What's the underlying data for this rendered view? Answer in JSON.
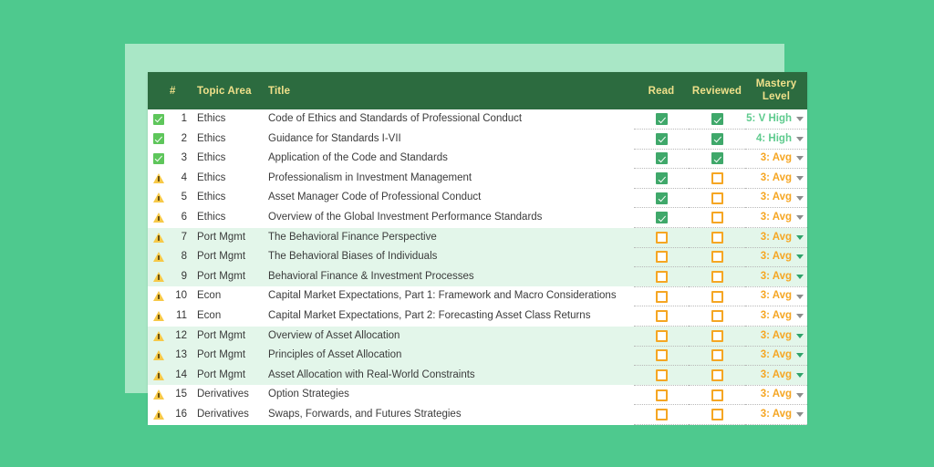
{
  "theme": {
    "page_background": "#4ec98e",
    "panel_background": "#a9e7c6",
    "card_background": "#ffffff",
    "header_background": "#2c6b3f",
    "header_text": "#efe08a",
    "row_alt_background": "#e3f6ea",
    "checked_box": "#3fa86a",
    "unchecked_box_border": "#f5a623",
    "mastery_green": "#5ecb8e",
    "mastery_orange": "#f5a623",
    "status_ok": "#5ec65b",
    "status_warn": "#f7c948"
  },
  "table": {
    "columns": {
      "status": "",
      "number": "#",
      "topic_area": "Topic Area",
      "title": "Title",
      "read": "Read",
      "reviewed": "Reviewed",
      "mastery_level_line1": "Mastery",
      "mastery_level_line2": "Level"
    },
    "rows": [
      {
        "status": "check-icon",
        "number": "1",
        "topic_area": "Ethics",
        "title": "Code of Ethics and Standards of Professional Conduct",
        "read": true,
        "reviewed": true,
        "mastery": "5: V High",
        "mastery_color": "green",
        "highlighted": false
      },
      {
        "status": "check-icon",
        "number": "2",
        "topic_area": "Ethics",
        "title": "Guidance for Standards I-VII",
        "read": true,
        "reviewed": true,
        "mastery": "4: High",
        "mastery_color": "green",
        "highlighted": false
      },
      {
        "status": "check-icon",
        "number": "3",
        "topic_area": "Ethics",
        "title": "Application of the Code and Standards",
        "read": true,
        "reviewed": true,
        "mastery": "3: Avg",
        "mastery_color": "orange",
        "highlighted": false
      },
      {
        "status": "warning-icon",
        "number": "4",
        "topic_area": "Ethics",
        "title": "Professionalism in Investment Management",
        "read": true,
        "reviewed": false,
        "mastery": "3: Avg",
        "mastery_color": "orange",
        "highlighted": false
      },
      {
        "status": "warning-icon",
        "number": "5",
        "topic_area": "Ethics",
        "title": "Asset Manager Code of Professional Conduct",
        "read": true,
        "reviewed": false,
        "mastery": "3: Avg",
        "mastery_color": "orange",
        "highlighted": false
      },
      {
        "status": "warning-icon",
        "number": "6",
        "topic_area": "Ethics",
        "title": "Overview of the Global Investment Performance Standards",
        "read": true,
        "reviewed": false,
        "mastery": "3: Avg",
        "mastery_color": "orange",
        "highlighted": false
      },
      {
        "status": "warning-icon",
        "number": "7",
        "topic_area": "Port Mgmt",
        "title": "The Behavioral Finance Perspective",
        "read": false,
        "reviewed": false,
        "mastery": "3: Avg",
        "mastery_color": "orange",
        "highlighted": true
      },
      {
        "status": "warning-icon",
        "number": "8",
        "topic_area": "Port Mgmt",
        "title": "The Behavioral Biases of Individuals",
        "read": false,
        "reviewed": false,
        "mastery": "3: Avg",
        "mastery_color": "orange",
        "highlighted": true
      },
      {
        "status": "warning-icon",
        "number": "9",
        "topic_area": "Port Mgmt",
        "title": "Behavioral Finance & Investment Processes",
        "read": false,
        "reviewed": false,
        "mastery": "3: Avg",
        "mastery_color": "orange",
        "highlighted": true
      },
      {
        "status": "warning-icon",
        "number": "10",
        "topic_area": "Econ",
        "title": "Capital Market Expectations, Part 1: Framework and Macro Considerations",
        "read": false,
        "reviewed": false,
        "mastery": "3: Avg",
        "mastery_color": "orange",
        "highlighted": false
      },
      {
        "status": "warning-icon",
        "number": "11",
        "topic_area": "Econ",
        "title": "Capital Market Expectations, Part 2: Forecasting Asset Class Returns",
        "read": false,
        "reviewed": false,
        "mastery": "3: Avg",
        "mastery_color": "orange",
        "highlighted": false
      },
      {
        "status": "warning-icon",
        "number": "12",
        "topic_area": "Port Mgmt",
        "title": "Overview of Asset Allocation",
        "read": false,
        "reviewed": false,
        "mastery": "3: Avg",
        "mastery_color": "orange",
        "highlighted": true
      },
      {
        "status": "warning-icon",
        "number": "13",
        "topic_area": "Port Mgmt",
        "title": "Principles of Asset Allocation",
        "read": false,
        "reviewed": false,
        "mastery": "3: Avg",
        "mastery_color": "orange",
        "highlighted": true
      },
      {
        "status": "warning-icon",
        "number": "14",
        "topic_area": "Port Mgmt",
        "title": "Asset Allocation with Real-World Constraints",
        "read": false,
        "reviewed": false,
        "mastery": "3: Avg",
        "mastery_color": "orange",
        "highlighted": true
      },
      {
        "status": "warning-icon",
        "number": "15",
        "topic_area": "Derivatives",
        "title": "Option Strategies",
        "read": false,
        "reviewed": false,
        "mastery": "3: Avg",
        "mastery_color": "orange",
        "highlighted": false
      },
      {
        "status": "warning-icon",
        "number": "16",
        "topic_area": "Derivatives",
        "title": "Swaps, Forwards, and Futures Strategies",
        "read": false,
        "reviewed": false,
        "mastery": "3: Avg",
        "mastery_color": "orange",
        "highlighted": false
      }
    ]
  }
}
